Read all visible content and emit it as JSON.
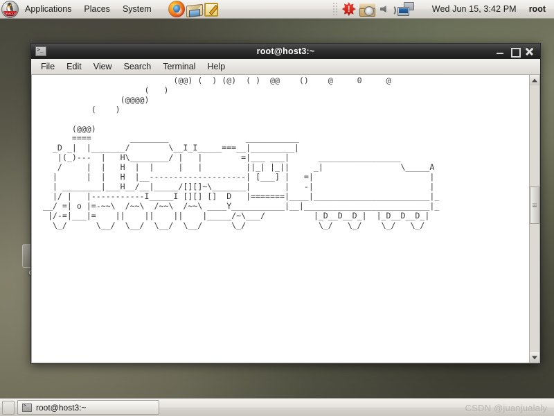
{
  "top_panel": {
    "logo_icon": "tux-oracle-logo-icon",
    "logo_band_text": "ORACLE",
    "menus": [
      {
        "label": "Applications",
        "name": "applications-menu"
      },
      {
        "label": "Places",
        "name": "places-menu"
      },
      {
        "label": "System",
        "name": "system-menu"
      }
    ],
    "launchers": [
      {
        "name": "firefox-icon",
        "title": "Firefox Web Browser"
      },
      {
        "name": "mail-icon",
        "title": "Evolution Mail"
      },
      {
        "name": "text-editor-icon",
        "title": "Text Editor"
      }
    ],
    "tray": [
      {
        "name": "alert-icon",
        "title": "Updates available"
      },
      {
        "name": "package-update-icon",
        "title": "Package Manager"
      },
      {
        "name": "volume-speaker-icon",
        "title": "Volume"
      },
      {
        "name": "network-monitors-icon",
        "title": "Network"
      }
    ],
    "clock": "Wed Jun 15,  3:42 PM",
    "user": "root"
  },
  "desktop": {
    "icon_label": "OL"
  },
  "window": {
    "title": "root@host3:~",
    "titlebar_icon": "terminal-icon",
    "controls": {
      "minimize": "minimize-button",
      "maximize": "maximize-button",
      "close": "close-button"
    },
    "menubar": [
      {
        "label": "File",
        "name": "menu-file"
      },
      {
        "label": "Edit",
        "name": "menu-edit"
      },
      {
        "label": "View",
        "name": "menu-view"
      },
      {
        "label": "Search",
        "name": "menu-search"
      },
      {
        "label": "Terminal",
        "name": "menu-terminal"
      },
      {
        "label": "Help",
        "name": "menu-help"
      }
    ],
    "terminal": {
      "program": "sl",
      "description": "steam locomotive ASCII animation",
      "foreground_color": "#3a3a3a",
      "background_color": "#ffffff",
      "ascii_art": "                             (@@) (  ) (@)  ( )  @@    ()    @     0     @\n                       (   )\n                  (@@@@)\n            (    )\n\n        (@@@)\n        ====        ________                ___________\n    _D _|  |_______/        \\__I_I_____===__|_________|\n     |(_)---  |   H\\________/ |   |        =|___ ___|      _________________\n     /     |  |   H  |  |     |   |         ||_| |_||     _|                \\_____A\n    |      |  |   H  |__--------------------| [___] |   =|                        |\n    | ________|___H__/__|_____/[][]~\\_______|       |   -|                        |\n    |/ |   |-----------I_____I [][] []  D   |=======|____|________________________|_\n  __/ =| o |=-~~\\  /~~\\  /~~\\  /~~\\ ____Y___________|__|__________________________|_\n   |/-=|___|=    ||    ||    ||    |_____/~\\___/          |_D__D__D_|  |_D__D__D_|\n    \\_/      \\__/  \\__/  \\__/  \\__/      \\_/               \\_/   \\_/    \\_/   \\_/"
    },
    "scrollbar": {
      "up_button": "scroll-up-button",
      "down_button": "scroll-down-button",
      "thumb": "scrollbar-thumb"
    }
  },
  "bottom_panel": {
    "show_desktop": "show-desktop-button",
    "tasks": [
      {
        "label": "root@host3:~",
        "name": "taskbar-item-terminal",
        "icon": "terminal-icon"
      }
    ]
  },
  "watermark": "CSDN @juanjualaly"
}
